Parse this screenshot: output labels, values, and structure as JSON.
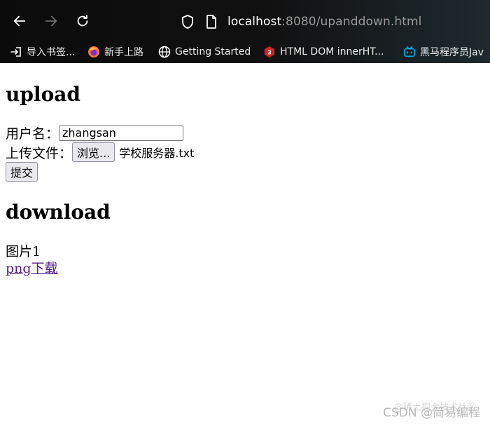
{
  "browser": {
    "url_host": "localhost",
    "url_rest": ":8080/upanddown.html",
    "bookmarks": [
      {
        "label": "导入书签...",
        "icon": "import-icon"
      },
      {
        "label": "新手上路",
        "icon": "firefox-icon"
      },
      {
        "label": "Getting Started",
        "icon": "globe-icon"
      },
      {
        "label": "HTML DOM innerHT...",
        "icon": "w3school-icon"
      },
      {
        "label": "黑马程序员Jav",
        "icon": "bilibili-icon"
      }
    ]
  },
  "page": {
    "upload_heading": "upload",
    "username_label": "用户名：",
    "username_value": "zhangsan",
    "file_label": "上传文件：",
    "browse_button": "浏览...",
    "file_name": "学校服务器.txt",
    "submit_button": "提交",
    "download_heading": "download",
    "picture_label": "图片1",
    "download_link": "png下载"
  },
  "watermark": {
    "main": "CSDN @简易编程",
    "sub": "@稀土掘金技术社区"
  }
}
